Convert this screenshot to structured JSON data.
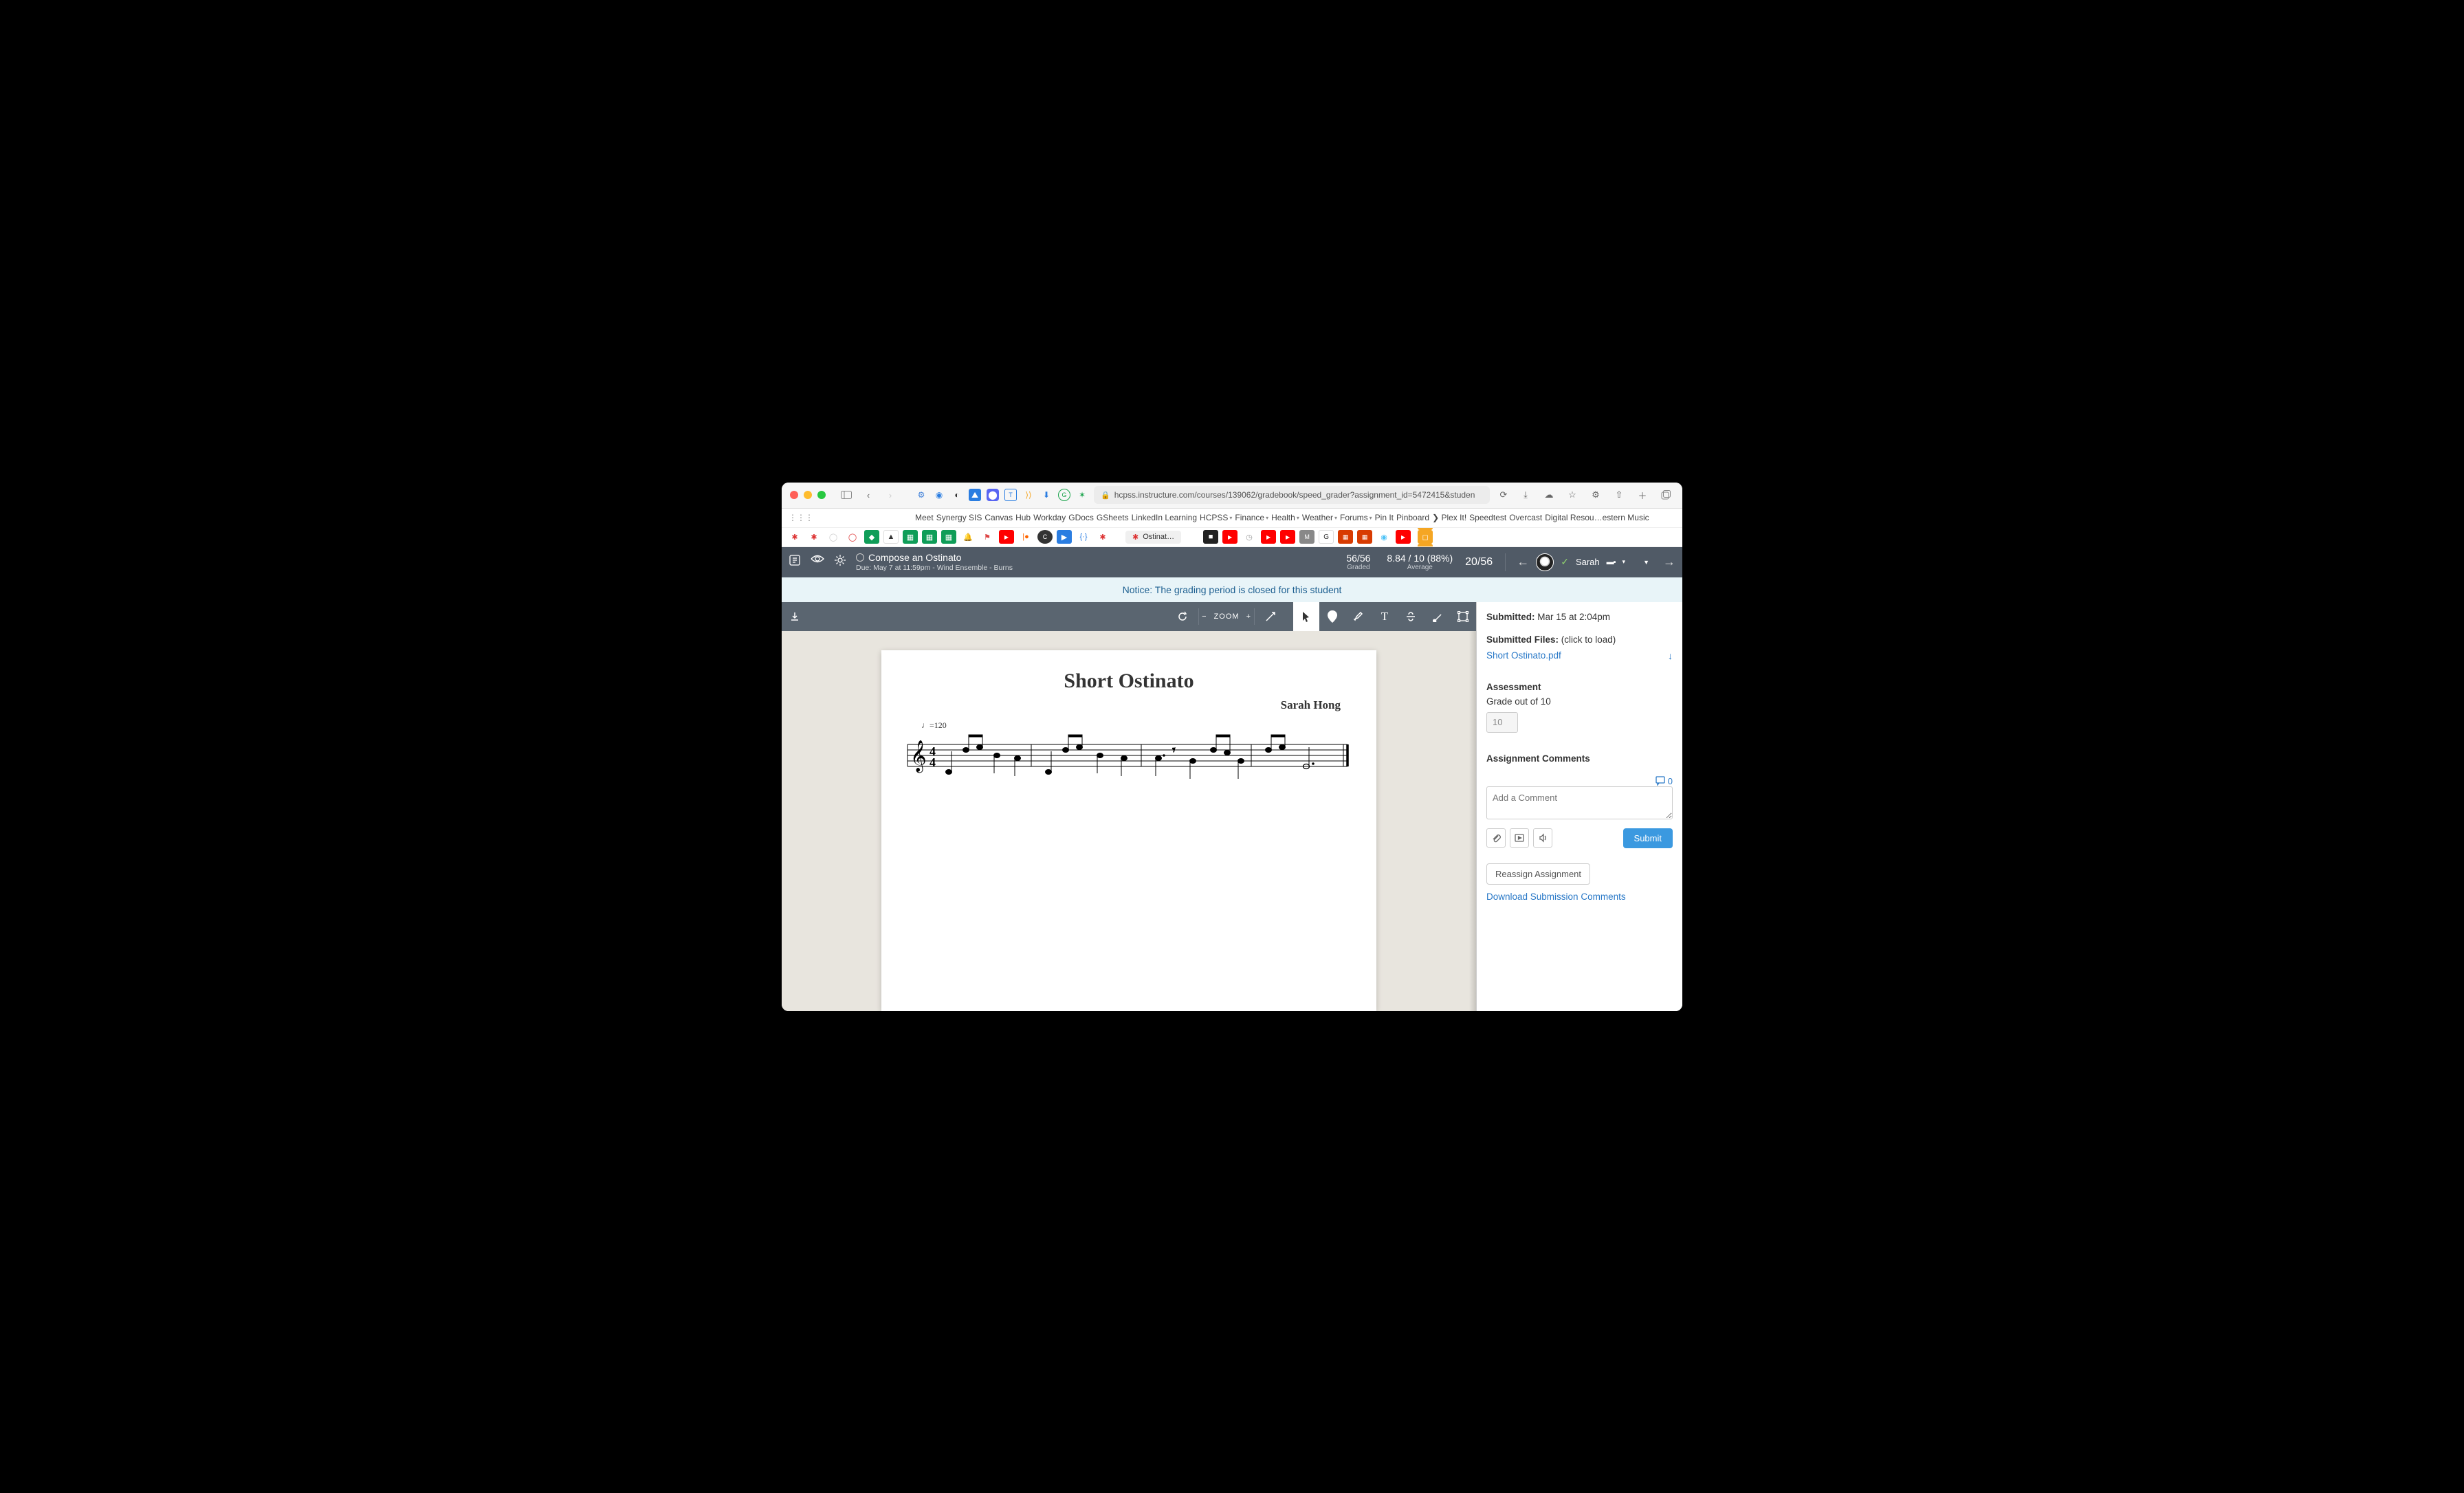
{
  "browser": {
    "url": "hcpss.instructure.com/courses/139062/gradebook/speed_grader?assignment_id=5472415&studen"
  },
  "bookmarks": {
    "row1": [
      "Meet",
      "Synergy SIS",
      "Canvas",
      "Hub",
      "Workday",
      "GDocs",
      "GSheets",
      "LinkedIn Learning",
      "HCPSS",
      "Finance",
      "Health",
      "Weather",
      "Forums",
      "Pin It",
      "Pinboard",
      "Plex It!",
      "Speedtest",
      "Overcast",
      "Digital Resou…estern Music"
    ],
    "has_chev": {
      "HCPSS": true,
      "Finance": true,
      "Health": true,
      "Weather": true,
      "Forums": true
    },
    "plex_prefix": "❯"
  },
  "tab": {
    "title": "Ostinat…"
  },
  "speedgrader": {
    "assignment_title": "Compose an Ostinato",
    "due_line": "Due: May 7 at 11:59pm - Wind Ensemble - Burns",
    "graded": {
      "value": "56/56",
      "label": "Graded"
    },
    "average": {
      "value": "8.84 / 10 (88%)",
      "label": "Average"
    },
    "count": "20/56",
    "student_name": "Sarah"
  },
  "notice": "Notice: The grading period is closed for this student",
  "doctool": {
    "zoom_label": "ZOOM"
  },
  "document": {
    "title": "Short Ostinato",
    "author": "Sarah Hong",
    "tempo": "♩=120"
  },
  "sidepanel": {
    "submitted_label": "Submitted:",
    "submitted_value": " Mar 15 at 2:04pm",
    "files_label": "Submitted Files:",
    "files_hint": " (click to load)",
    "file_name": "Short Ostinato.pdf",
    "assessment_header": "Assessment",
    "grade_label": "Grade out of 10",
    "grade_value": "10",
    "comments_header": "Assignment Comments",
    "comment_count": "0",
    "comment_placeholder": "Add a Comment",
    "submit_label": "Submit",
    "reassign_label": "Reassign Assignment",
    "download_comments": "Download Submission Comments"
  }
}
